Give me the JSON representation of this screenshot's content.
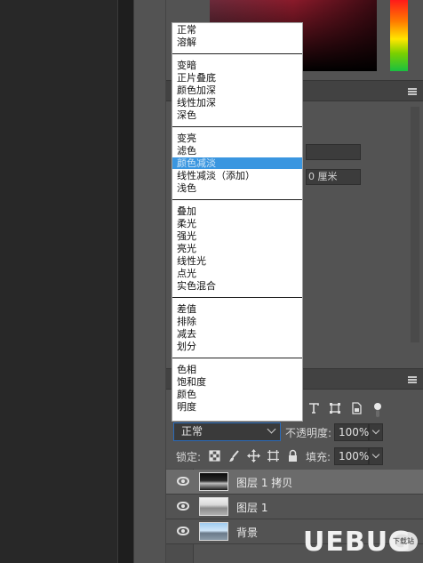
{
  "blend_mode_menu": {
    "groups": [
      [
        "正常",
        "溶解"
      ],
      [
        "变暗",
        "正片叠底",
        "颜色加深",
        "线性加深",
        "深色"
      ],
      [
        "变亮",
        "滤色",
        "颜色减淡",
        "线性减淡（添加）",
        "浅色"
      ],
      [
        "叠加",
        "柔光",
        "强光",
        "亮光",
        "线性光",
        "点光",
        "实色混合"
      ],
      [
        "差值",
        "排除",
        "减去",
        "划分"
      ],
      [
        "色相",
        "饱和度",
        "颜色",
        "明度"
      ]
    ],
    "highlighted": "颜色减淡"
  },
  "properties": {
    "unit_value": "0 厘米"
  },
  "layers_panel": {
    "blend_mode": "正常",
    "opacity_label": "不透明度:",
    "opacity_value": "100%",
    "lock_label": "锁定:",
    "fill_label": "填充:",
    "fill_value": "100%",
    "layers": [
      {
        "name": "图层 1 拷贝",
        "selected": true
      },
      {
        "name": "图层 1",
        "selected": false
      },
      {
        "name": "背景",
        "selected": false
      }
    ]
  },
  "watermark": {
    "logo": "UEBUG",
    "badge": "下载站"
  },
  "colors": {
    "highlight": "#3a96e0",
    "panel_bg": "#535353",
    "selected_row": "#6b6b6b"
  }
}
